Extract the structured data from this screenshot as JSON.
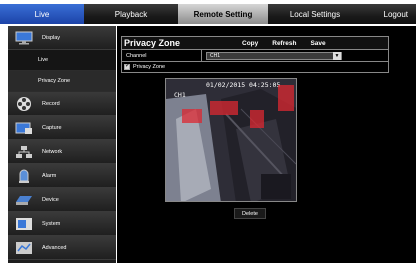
{
  "nav": {
    "live": "Live",
    "playback": "Playback",
    "remote_setting": "Remote Setting",
    "local_settings": "Local Settings",
    "logout": "Logout"
  },
  "sidebar": {
    "display": "Display",
    "live": "Live",
    "privacy_zone": "Privacy Zone",
    "record": "Record",
    "capture": "Capture",
    "network": "Network",
    "alarm": "Alarm",
    "device": "Device",
    "system": "System",
    "advanced": "Advanced"
  },
  "panel": {
    "title": "Privacy Zone",
    "copy": "Copy",
    "refresh": "Refresh",
    "save": "Save",
    "channel_label": "Channel",
    "channel_value": "CH1",
    "privacy_zone_checkbox": "Privacy Zone"
  },
  "video": {
    "timestamp": "01/02/2015 04:25:05",
    "channel_osd": "CH1"
  },
  "delete_label": "Delete",
  "colors": {
    "accent_live": "#2a5bc4",
    "zone": "#dc2832"
  }
}
